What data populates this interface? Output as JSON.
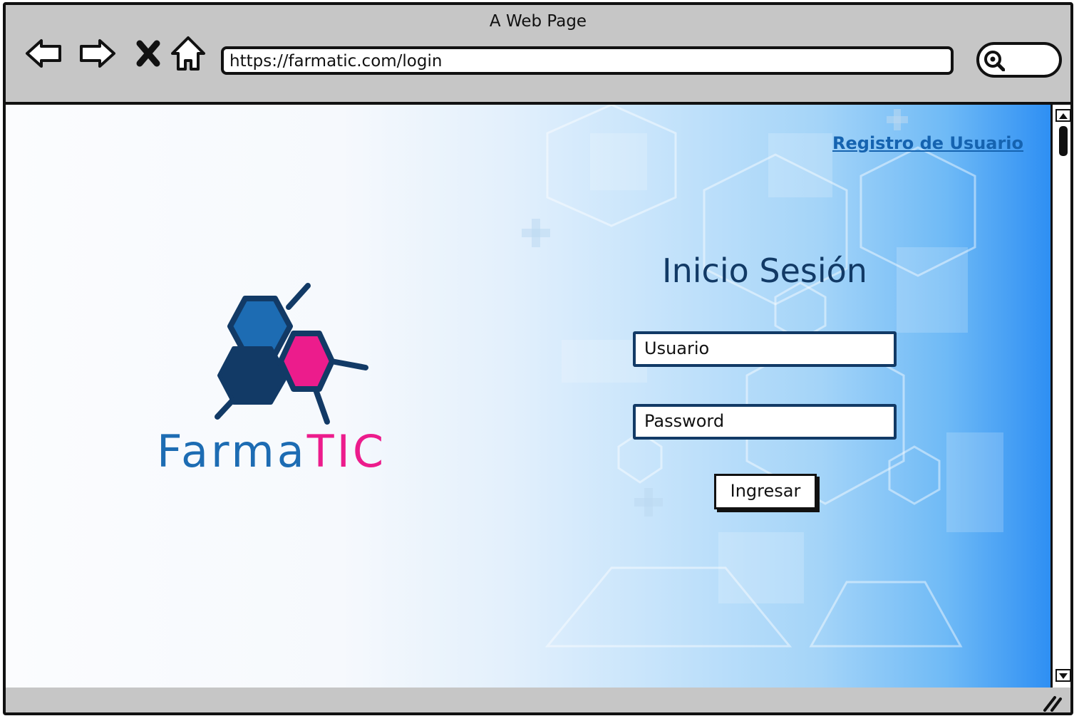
{
  "window": {
    "title": "A Web Page"
  },
  "browser": {
    "url": "https://farmatic.com/login",
    "nav_icons": [
      "back-arrow-icon",
      "forward-arrow-icon",
      "close-x-icon",
      "home-icon"
    ],
    "search_icon": "search-icon"
  },
  "header": {
    "register_link": "Registro de Usuario"
  },
  "brand": {
    "name_part1": "Farma",
    "name_part2": "TIC"
  },
  "login": {
    "title": "Inicio Sesión",
    "username_placeholder": "Usuario",
    "password_placeholder": "Password",
    "submit_label": "Ingresar"
  },
  "colors": {
    "brand_blue": "#1d6cb3",
    "brand_pink": "#ec1c8c",
    "brand_navy": "#123a66",
    "link_blue": "#1563b0"
  }
}
